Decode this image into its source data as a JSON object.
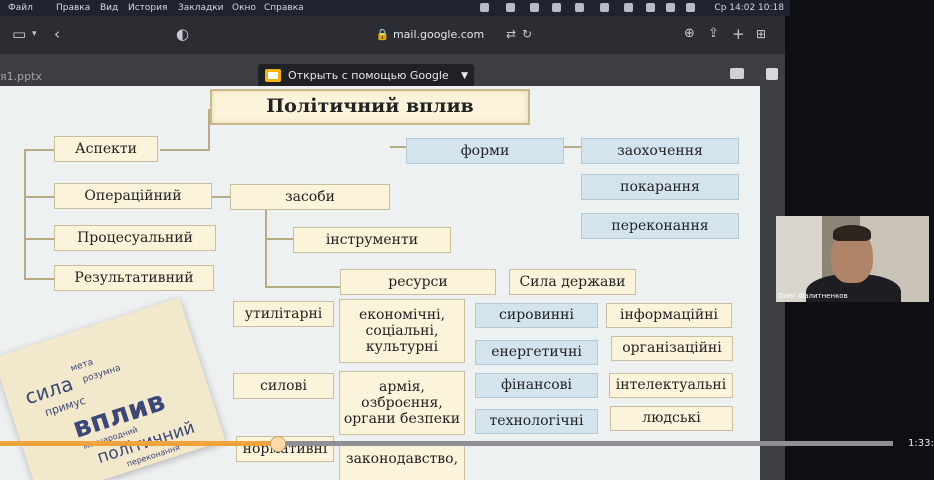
{
  "menubar": {
    "items": [
      "Файл",
      "Правка",
      "Вид",
      "История",
      "Закладки",
      "Окно",
      "Справка"
    ],
    "clock": "Ср 14:02 10:18"
  },
  "browser": {
    "url": "mail.google.com",
    "file_name": "я1.pptx",
    "open_with": "Открыть с помощью Google Пр..."
  },
  "slide": {
    "title": "Політичний вплив",
    "aspects": [
      "Аспекти",
      "Операційний",
      "Процесуальний",
      "Результативний"
    ],
    "labels": {
      "forms": "форми",
      "means": "засоби",
      "instruments": "інструменти",
      "resources": "ресурси",
      "state_power": "Сила держави"
    },
    "methods": [
      "заохочення",
      "покарання",
      "переконання"
    ],
    "resource_types": [
      "утилітарні",
      "силові",
      "нормативні"
    ],
    "resource_kinds": [
      "економічні,\nсоціальні,\nкультурні",
      "армія,\nозброєння,\nоргани безпеки",
      "законодавство,"
    ],
    "state_col1": [
      "сировинні",
      "енергетичні",
      "фінансові",
      "технологічні"
    ],
    "state_col2": [
      "інформаційні",
      "організаційні",
      "інтелектуальні",
      "людські"
    ],
    "wordcloud": [
      "сила",
      "мета",
      "розумна",
      "примус",
      "вплив",
      "міжнародний",
      "політичний",
      "переконання"
    ]
  },
  "webcam": {
    "name": "Олег Фалитненков"
  },
  "video": {
    "timestamp": "1:33:4",
    "progress": 0.31
  }
}
